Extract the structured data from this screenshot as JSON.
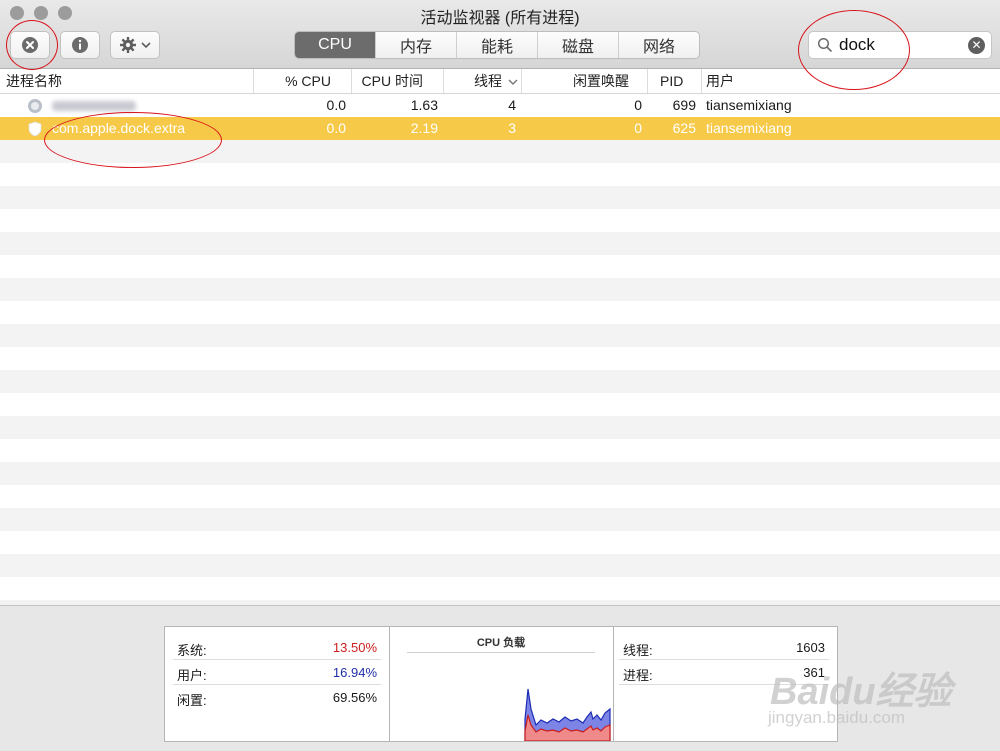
{
  "window": {
    "title": "活动监视器 (所有进程)",
    "traffic_color": "#9c9c9c"
  },
  "toolbar": {
    "buttons": [
      {
        "name": "stop-process",
        "icon": "close-circle-icon"
      },
      {
        "name": "inspect",
        "icon": "info-icon"
      },
      {
        "name": "action-menu",
        "icon": "gear-icon"
      }
    ],
    "tabs": [
      "CPU",
      "内存",
      "能耗",
      "磁盘",
      "网络"
    ],
    "active_tab": "CPU",
    "search": {
      "value": "dock",
      "icon": "search-icon"
    }
  },
  "table": {
    "columns": [
      "进程名称",
      "% CPU",
      "CPU 时间",
      "线程",
      "闲置唤醒",
      "PID",
      "用户"
    ],
    "sort_column": "线程",
    "sort_indicator": "chevron-down-icon",
    "rows": [
      {
        "name": "",
        "name_blurred": true,
        "cpu": "0.0",
        "cpu_time": "1.63",
        "threads": "4",
        "idle_wakeups": "0",
        "pid": "699",
        "user": "tiansemixiang",
        "selected": false
      },
      {
        "name": "com.apple.dock.extra",
        "name_blurred": false,
        "cpu": "0.0",
        "cpu_time": "2.19",
        "threads": "3",
        "idle_wakeups": "0",
        "pid": "625",
        "user": "tiansemixiang",
        "selected": true
      }
    ],
    "selected_color": "#f7c948"
  },
  "stats": {
    "left": [
      {
        "label": "系统:",
        "value": "13.50%",
        "color": "#cc1f1f"
      },
      {
        "label": "用户:",
        "value": "16.94%",
        "color": "#1f2fa8"
      },
      {
        "label": "闲置:",
        "value": "69.56%",
        "color": "#1a1a1a"
      }
    ],
    "chart_title": "CPU 负载",
    "right": [
      {
        "label": "线程:",
        "value": "1603"
      },
      {
        "label": "进程:",
        "value": "361"
      }
    ]
  },
  "watermark": {
    "brand": "Baidu经验",
    "url": "jingyan.baidu.com"
  }
}
